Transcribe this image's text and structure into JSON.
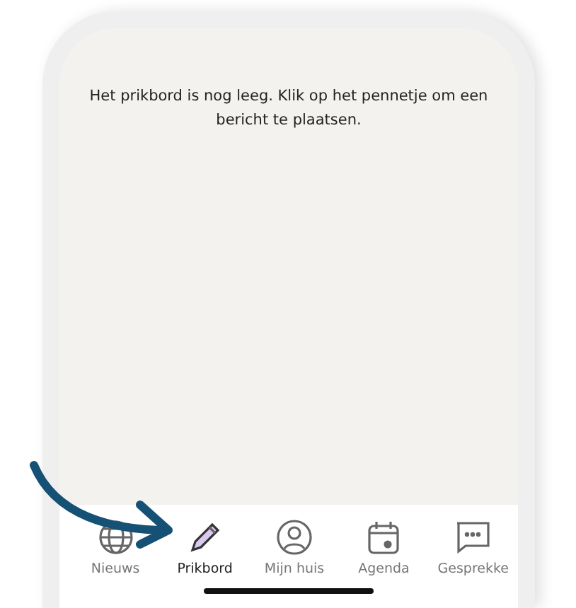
{
  "message": "Het prikbord is nog leeg. Klik op het pennetje om een bericht te plaatsen.",
  "nav": [
    {
      "label": "Nieuws",
      "kind": "globe",
      "selected": false
    },
    {
      "label": "Prikbord",
      "kind": "pencil",
      "selected": true
    },
    {
      "label": "Mijn huis",
      "kind": "person",
      "selected": false
    },
    {
      "label": "Agenda",
      "kind": "calendar",
      "selected": false
    },
    {
      "label": "Gesprekke",
      "kind": "chat",
      "selected": false
    }
  ]
}
